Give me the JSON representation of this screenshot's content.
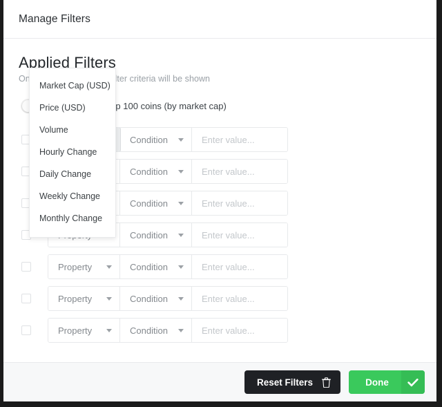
{
  "dialog": {
    "title": "Manage Filters"
  },
  "section": {
    "heading": "Applied Filters",
    "subheading": "Only coins matching all filter criteria will be shown"
  },
  "toggle": {
    "label": "Show only top 100 coins (by market cap)",
    "state": "off"
  },
  "filters": {
    "property_label": "Property",
    "condition_label": "Condition",
    "value_placeholder": "Enter value...",
    "rows": [
      {
        "property": "Property",
        "condition": "Condition",
        "value": "",
        "checked": false,
        "open": true
      },
      {
        "property": "Property",
        "condition": "Condition",
        "value": "",
        "checked": false,
        "open": false
      },
      {
        "property": "Property",
        "condition": "Condition",
        "value": "",
        "checked": false,
        "open": false
      },
      {
        "property": "Property",
        "condition": "Condition",
        "value": "",
        "checked": false,
        "open": false
      },
      {
        "property": "Property",
        "condition": "Condition",
        "value": "",
        "checked": false,
        "open": false
      },
      {
        "property": "Property",
        "condition": "Condition",
        "value": "",
        "checked": false,
        "open": false
      },
      {
        "property": "Property",
        "condition": "Condition",
        "value": "",
        "checked": false,
        "open": false
      }
    ]
  },
  "property_dropdown": {
    "open": true,
    "options": [
      "Market Cap (USD)",
      "Price (USD)",
      "Volume",
      "Hourly Change",
      "Daily Change",
      "Weekly Change",
      "Monthly Change"
    ]
  },
  "footer": {
    "reset_label": "Reset Filters",
    "done_label": "Done"
  },
  "colors": {
    "accent_green": "#3ac95c",
    "dark_button": "#1f2125",
    "footer_bg": "#f7f8f9",
    "border": "#e7e9eb"
  }
}
